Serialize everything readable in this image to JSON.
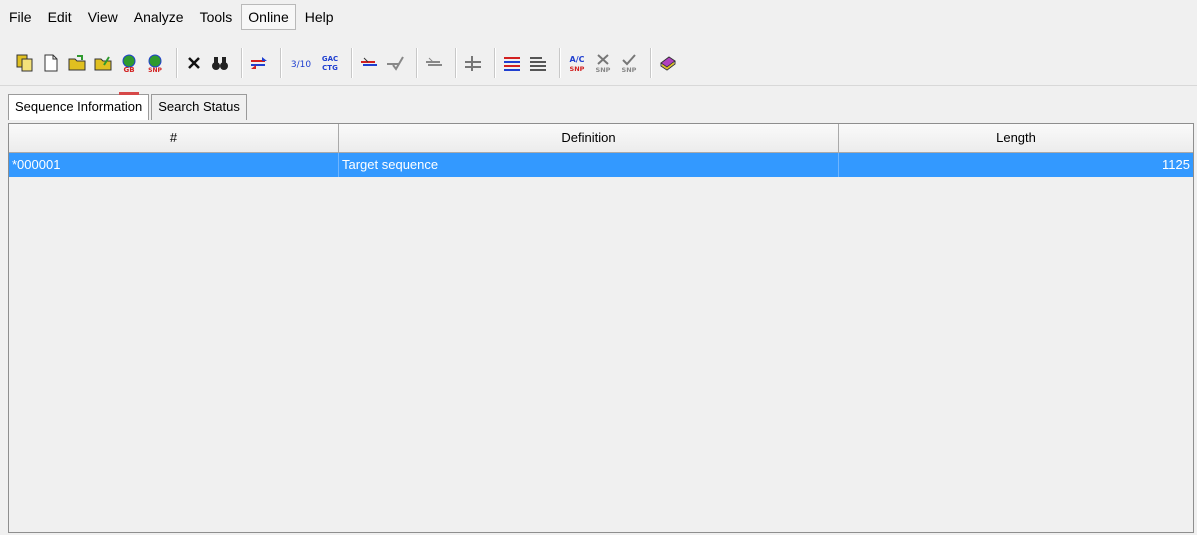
{
  "menu": {
    "items": [
      {
        "label": "File"
      },
      {
        "label": "Edit"
      },
      {
        "label": "View"
      },
      {
        "label": "Analyze"
      },
      {
        "label": "Tools"
      },
      {
        "label": "Online"
      },
      {
        "label": "Help"
      }
    ]
  },
  "toolbar": {
    "texts": {
      "ratio": "3/10",
      "gac": "GAC",
      "ctg": "CTG",
      "snp": "SNP",
      "ac": "A/C",
      "gb": "GB"
    }
  },
  "tabs": [
    {
      "label": "Sequence Information"
    },
    {
      "label": "Search Status"
    }
  ],
  "table": {
    "headers": {
      "num": "#",
      "definition": "Definition",
      "length": "Length"
    },
    "rows": [
      {
        "num": "*000001",
        "definition": "Target sequence",
        "length": "1125"
      }
    ]
  },
  "colors": {
    "selection": "#3399ff",
    "icon_red": "#d22020",
    "icon_blue": "#1f3fd0",
    "icon_green": "#2f9a2f",
    "icon_yellow": "#e0c020"
  }
}
